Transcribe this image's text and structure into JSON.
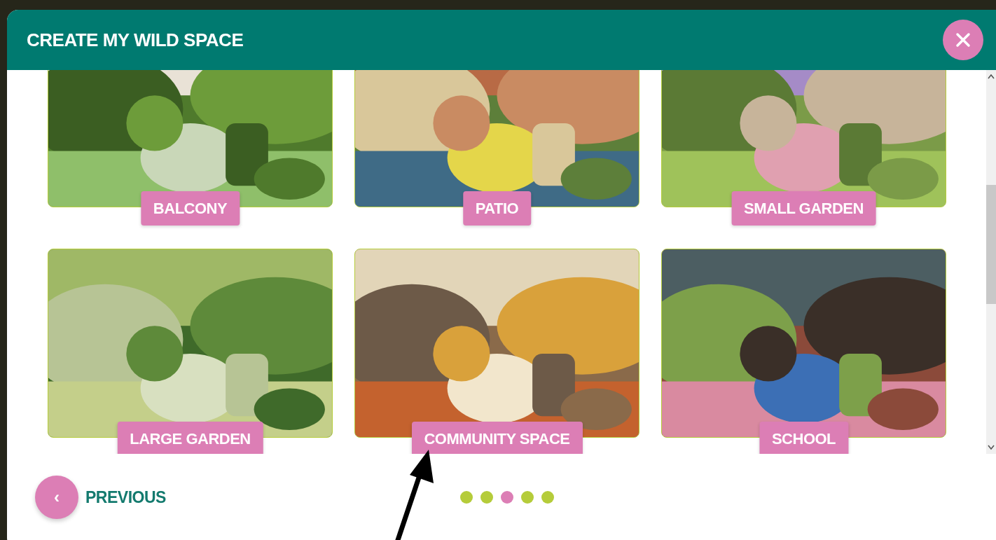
{
  "dialog": {
    "title": "CREATE MY WILD SPACE"
  },
  "options": [
    {
      "label": "BALCONY",
      "kind": "picture"
    },
    {
      "label": "PATIO",
      "kind": "picture"
    },
    {
      "label": "SMALL GARDEN",
      "kind": "picture"
    },
    {
      "label": "LARGE GARDEN",
      "kind": "picture"
    },
    {
      "label": "COMMUNITY SPACE",
      "kind": "picture"
    },
    {
      "label": "SCHOOL",
      "kind": "picture"
    }
  ],
  "footer": {
    "previous": "PREVIOUS",
    "caret": "‹"
  },
  "steps": [
    {
      "selected": false
    },
    {
      "selected": false
    },
    {
      "selected": true
    },
    {
      "selected": false
    },
    {
      "selected": false
    }
  ]
}
